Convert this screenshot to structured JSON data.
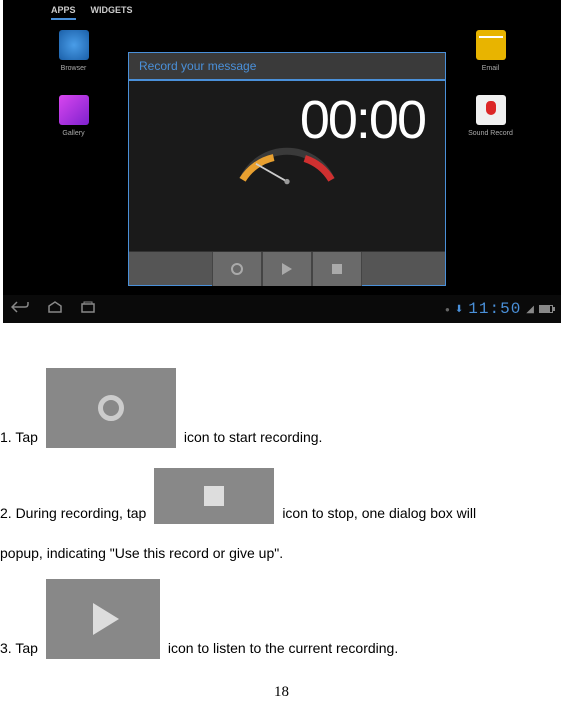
{
  "tabs": {
    "apps": "APPS",
    "widgets": "WIDGETS"
  },
  "apps": {
    "browser": "Browser",
    "email": "Email",
    "gallery": "Gallery",
    "soundrecord": "Sound Record"
  },
  "recorder": {
    "title": "Record your message",
    "timer": "00:00"
  },
  "statusbar": {
    "time": "11:50"
  },
  "instructions": {
    "step1_pre": "1. Tap",
    "step1_post": "icon to start recording.",
    "step2_pre": "2.  During  recording,  tap",
    "step2_post": "icon  to  stop,  one  dialog  box  will",
    "step2_line2": "popup, indicating \"Use this record or give up\".",
    "step3_pre": "3. Tap",
    "step3_post": "icon to listen to the current recording."
  },
  "pageNumber": "18"
}
